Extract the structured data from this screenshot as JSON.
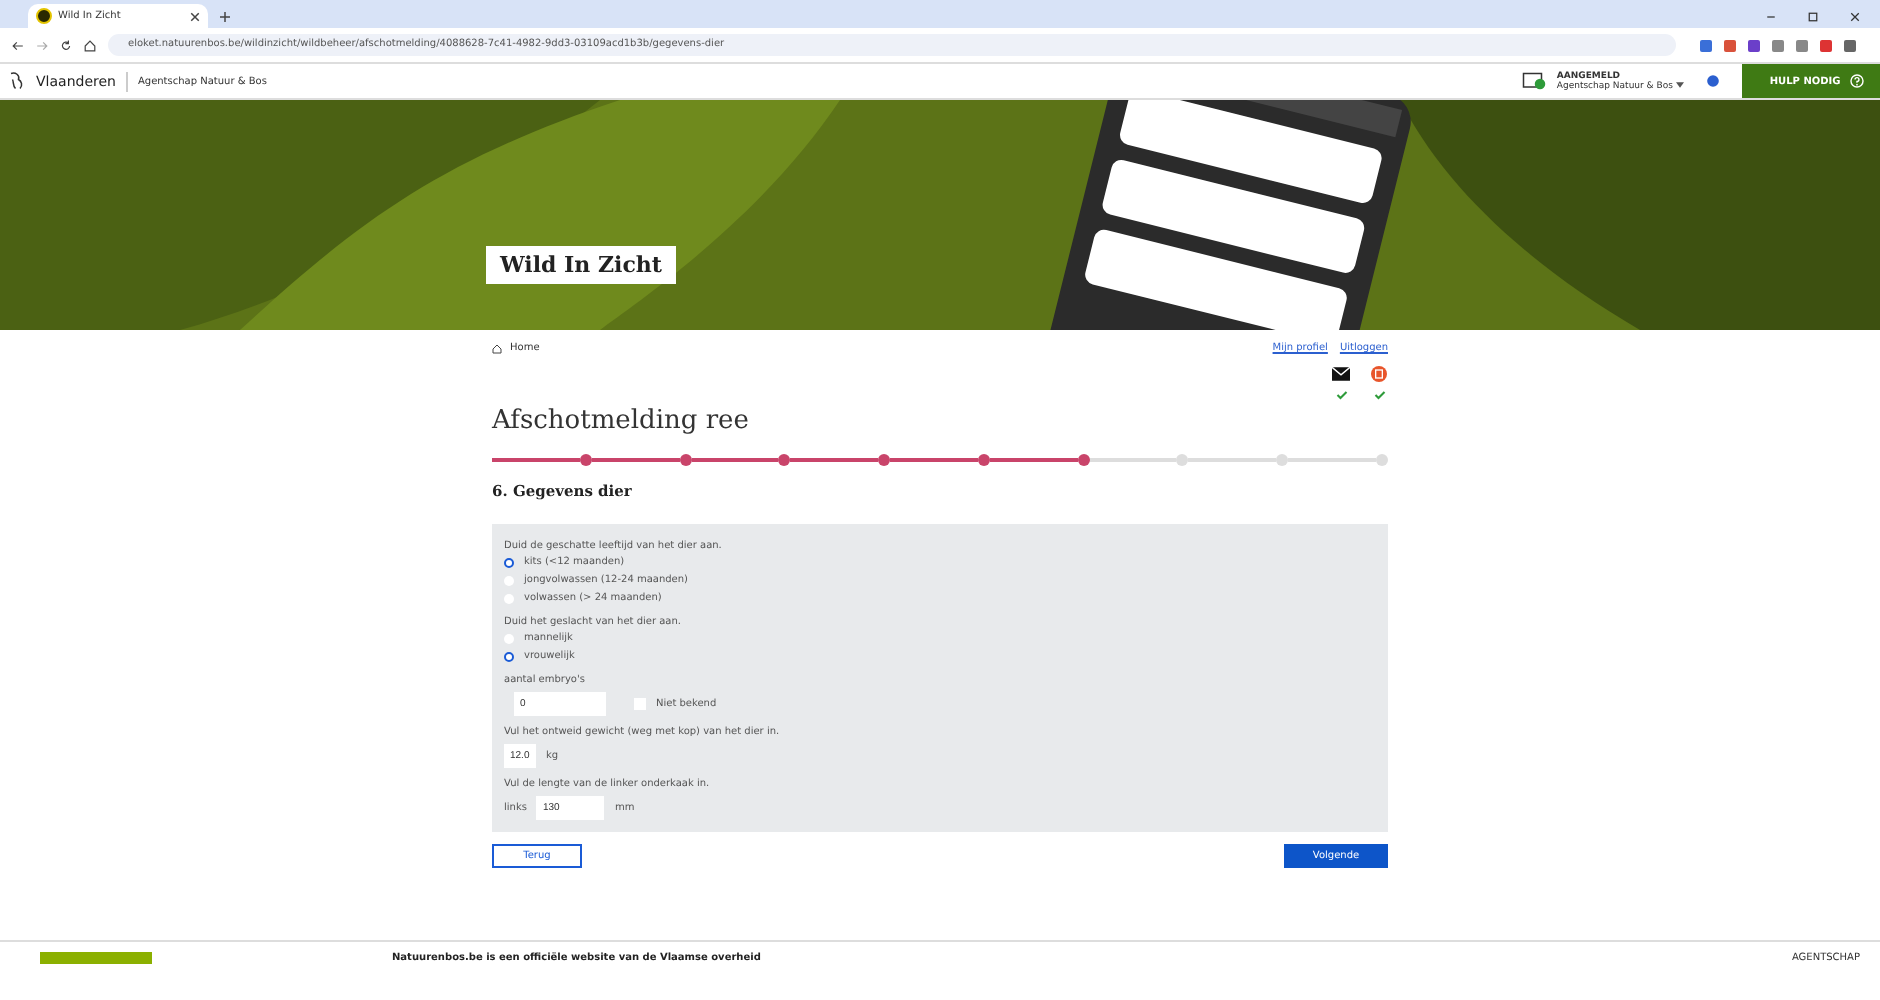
{
  "browser": {
    "tab_title": "Wild In Zicht",
    "url": "eloket.natuurenbos.be/wildinzicht/wildbeheer/afschotmelding/4088628-7c41-4982-9dd3-03109acd1b3b/gegevens-dier"
  },
  "site_header": {
    "brand": "Vlaanderen",
    "agency": "Agentschap Natuur & Bos",
    "status": "AANGEMELD",
    "user": "Agentschap Natuur & Bos",
    "help": "HULP NODIG"
  },
  "banner": {
    "title": "Wild In Zicht"
  },
  "breadcrumb": "Home",
  "profile_links": [
    "Mijn profiel",
    "Uitloggen"
  ],
  "notifications": [
    {
      "kind": "mail",
      "checked": true
    },
    {
      "kind": "badge",
      "checked": true
    }
  ],
  "title": "Afschotmelding ree",
  "steps": [
    {
      "done": true
    },
    {
      "done": true
    },
    {
      "done": true
    },
    {
      "done": true
    },
    {
      "done": true
    },
    {
      "done": true
    },
    {
      "done": false
    },
    {
      "done": false
    },
    {
      "done": false
    }
  ],
  "section_title": "6. Gegevens dier",
  "questions": [
    {
      "kind": "radio",
      "label": "Duid de geschatte leeftijd van het dier aan.",
      "options": [
        {
          "label": "kits (<12 maanden)",
          "selected": true
        },
        {
          "label": "jongvolwassen (12-24 maanden)",
          "selected": false
        },
        {
          "label": "volwassen (> 24 maanden)",
          "selected": false
        }
      ]
    },
    {
      "kind": "radio",
      "label": "Duid het geslacht van het dier aan.",
      "options": [
        {
          "label": "mannelijk",
          "selected": false
        },
        {
          "label": "vrouwelijk",
          "selected": true
        }
      ]
    },
    {
      "kind": "input-check",
      "label": "aantal embryo's",
      "value": "0",
      "check_label": "Niet bekend",
      "checked": false
    },
    {
      "kind": "input-unit",
      "label": "Vul het ontweid gewicht (weg met kop) van het dier in.",
      "value": "12.0",
      "unit": "kg"
    },
    {
      "kind": "input-unit",
      "label": "Vul de lengte van de linker onderkaak in.",
      "prefix": "links",
      "value": "130",
      "unit": "mm"
    }
  ],
  "buttons": {
    "back": "Terug",
    "next": "Volgende"
  },
  "footer": {
    "text": "Natuurenbos.be is een officiële website van de Vlaamse overheid",
    "right": "AGENTSCHAP"
  }
}
